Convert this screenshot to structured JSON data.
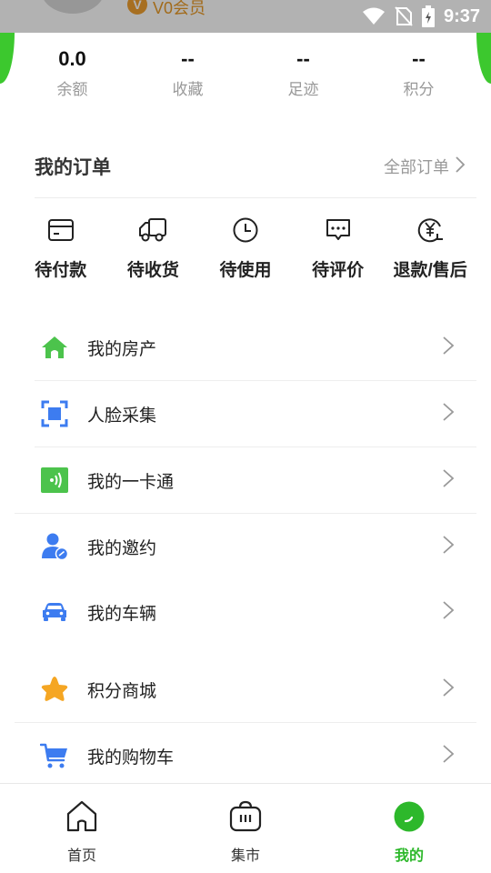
{
  "status_bar": {
    "time": "9:37"
  },
  "profile": {
    "vip_badge": "V",
    "member_level": "V0会员"
  },
  "stats": [
    {
      "value": "0.0",
      "label": "余额"
    },
    {
      "value": "--",
      "label": "收藏"
    },
    {
      "value": "--",
      "label": "足迹"
    },
    {
      "value": "--",
      "label": "积分"
    }
  ],
  "orders": {
    "title": "我的订单",
    "all_label": "全部订单",
    "items": [
      {
        "label": "待付款",
        "icon": "card-icon"
      },
      {
        "label": "待收货",
        "icon": "truck-icon"
      },
      {
        "label": "待使用",
        "icon": "clock-icon"
      },
      {
        "label": "待评价",
        "icon": "comment-icon"
      },
      {
        "label": "退款/售后",
        "icon": "yen-refund-icon"
      }
    ]
  },
  "menu": [
    {
      "label": "我的房产",
      "icon": "house-icon",
      "color": "#4cc34c"
    },
    {
      "label": "人脸采集",
      "icon": "face-scan-icon",
      "color": "#3d7cf0"
    },
    {
      "label": "我的一卡通",
      "icon": "card-signal-icon",
      "color": "#4cc34c"
    },
    {
      "label": "我的邀约",
      "icon": "user-invite-icon",
      "color": "#3d7cf0"
    },
    {
      "label": "我的车辆",
      "icon": "car-icon",
      "color": "#3d7cf0"
    },
    {
      "label": "积分商城",
      "icon": "star-icon",
      "color": "#f5a623"
    },
    {
      "label": "我的购物车",
      "icon": "cart-icon",
      "color": "#3d7cf0"
    }
  ],
  "bottom_nav": [
    {
      "label": "首页",
      "icon": "home-icon"
    },
    {
      "label": "集市",
      "icon": "basket-icon"
    },
    {
      "label": "我的",
      "icon": "profile-icon",
      "active": true
    }
  ],
  "colors": {
    "accent": "#2db82b",
    "brand_green": "#3cc82e",
    "vip_orange": "#f0a030"
  }
}
